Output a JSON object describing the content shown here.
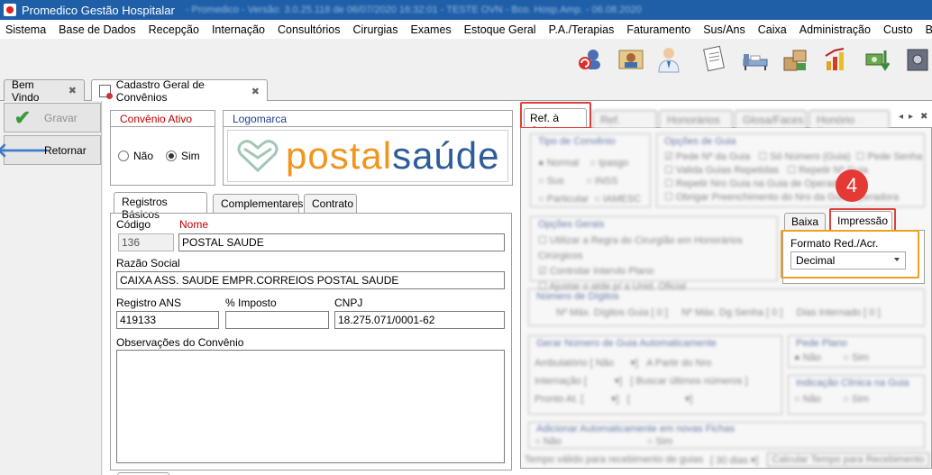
{
  "window": {
    "title": "Promedico Gestão Hospitalar",
    "subtitle": "- Promedico - Versão: 3.0.25.118 de 06/07/2020 16:32:01 - TESTE OVN - Bco. Hosp.Amp. - 06.08.2020"
  },
  "menu": [
    "Sistema",
    "Base de Dados",
    "Recepção",
    "Internação",
    "Consultórios",
    "Cirurgias",
    "Exames",
    "Estoque Geral",
    "P.A./Terapias",
    "Faturamento",
    "Sus/Ans",
    "Caixa",
    "Administração",
    "Custo",
    "BI"
  ],
  "doc_tabs": {
    "welcome": "Bem Vindo",
    "active": "Cadastro Geral de Convênios",
    "close_glyph": "✖"
  },
  "side": {
    "save": "Gravar",
    "back": "Retornar"
  },
  "convenio_ativo": {
    "title": "Convênio Ativo",
    "no": "Não",
    "yes": "Sim"
  },
  "logomarca": {
    "title": "Logomarca",
    "logo_text_a": "postal",
    "logo_text_b": "saúde"
  },
  "sub_tabs": [
    "Registros Básicos",
    "Complementares",
    "Contrato"
  ],
  "form": {
    "codigo_label": "Código",
    "codigo": "136",
    "nome_label": "Nome",
    "nome": "POSTAL SAUDE",
    "razao_label": "Razão Social",
    "razao": "CAIXA ASS. SAUDE EMPR.CORREIOS POSTAL SAUDE",
    "ans_label": "Registro ANS",
    "ans": "419133",
    "imposto_label": "% Imposto",
    "imposto": "",
    "cnpj_label": "CNPJ",
    "cnpj": "18.275.071/0001-62",
    "obs_label": "Observações do Convênio"
  },
  "right_tabs": {
    "active": "Ref. à Guia",
    "others": [
      "Ref. p/Pagto",
      "Honorários",
      "Glosa/Faces",
      "Honório Espeic"
    ]
  },
  "inner_tabs": {
    "baixa": "Baixa",
    "impressao": "Impressão"
  },
  "impressao": {
    "label": "Formato Red./Acr.",
    "value": "Decimal"
  },
  "step_badge": "4",
  "blurred": {
    "tipo_convenio": "Tipo de Convênio",
    "opcoes_guia": "Opções de Guia",
    "opcoes_gerais": "Opções Gerais",
    "numero_digitos": "Número de Dígitos",
    "gerar_numero": "Gerar Número de Guia Automaticamente",
    "pede_plano": "Pede Plano",
    "indicacao": "Indicação Clínica na Guia",
    "adicionar": "Adicionar Automaticamente em novas Fichas",
    "tempo": "Tempo válido para recebimento de guias",
    "calcular": "Calcular Tempo para Recebimento"
  },
  "colors": {
    "titlebar": "#1e5fa8",
    "highlight_red": "#e0403a",
    "highlight_orange": "#f0a020",
    "badge": "#e53935",
    "logo_orange": "#f0951e",
    "logo_blue": "#2e5c9a"
  }
}
